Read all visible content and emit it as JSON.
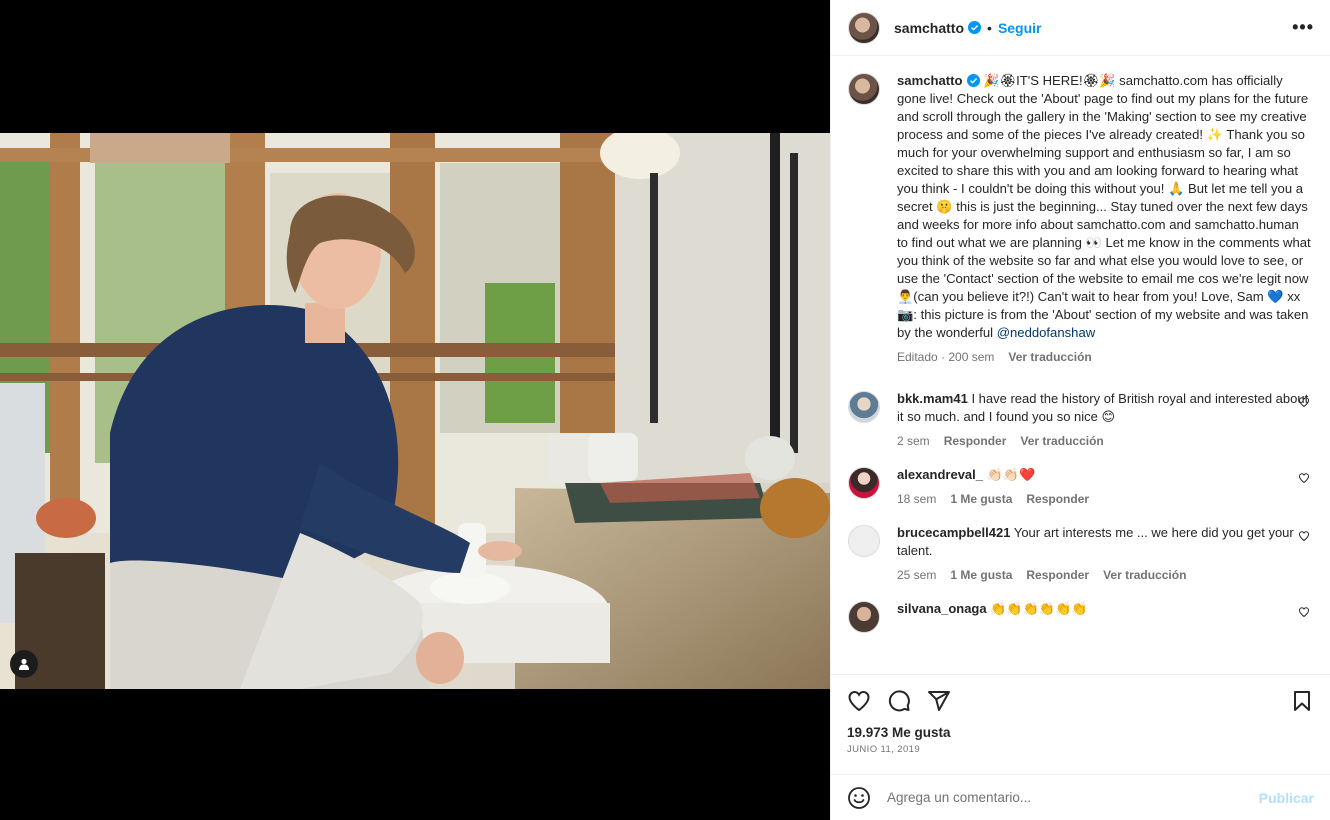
{
  "post": {
    "username": "samchatto",
    "dot": "•",
    "follow_label": "Seguir",
    "more_label": "•••"
  },
  "caption": {
    "username": "samchatto",
    "text": "🎉🏵IT'S HERE!🏵🎉 samchatto.com has officially gone live! Check out the 'About' page to find out my plans for the future and scroll through the gallery in the 'Making' section to see my creative process and some of the pieces I've already created! ✨ Thank you so much for your overwhelming support and enthusiasm so far, I am so excited to share this with you and am looking forward to hearing what you think - I couldn't be doing this without you! 🙏 But let me tell you a secret 🤫 this is just the beginning... Stay tuned over the next few days and weeks for more info about samchatto.com and samchatto.human to find out what we are planning 👀 Let me know in the comments what you think of the website so far and what else you would love to see, or use the 'Contact' section of the website to email me cos we're legit now 👨‍💼(can you believe it?!) Can't wait to hear from you! Love, Sam 💙 xx 📷: this picture is from the 'About' section of my website and was taken by the wonderful ",
    "mention": "@neddofanshaw",
    "edited": "Editado · 200 sem",
    "translate": "Ver traducción"
  },
  "comments": [
    {
      "username": "bkk.mam41",
      "text": "I have read the history of British royal and interested about it so much. and I found you so nice 😊",
      "time": "2 sem",
      "reply": "Responder",
      "translate": "Ver traducción"
    },
    {
      "username": "alexandreval_",
      "text": "👏🏻👏🏻❤️",
      "time": "18 sem",
      "likes": "1 Me gusta",
      "reply": "Responder"
    },
    {
      "username": "brucecampbell421",
      "text": "Your art interests me ... we here did you get your talent.",
      "time": "25 sem",
      "likes": "1 Me gusta",
      "reply": "Responder",
      "translate": "Ver traducción"
    },
    {
      "username": "silvana_onaga",
      "text": "👏👏👏👏👏👏"
    }
  ],
  "stats": {
    "likes": "19.973 Me gusta",
    "date": "JUNIO 11, 2019"
  },
  "composer": {
    "placeholder": "Agrega un comentario...",
    "publish_label": "Publicar"
  },
  "colors": {
    "accent": "#0095f6",
    "publish_disabled": "#b2dffc",
    "verified": "#0095f6"
  }
}
